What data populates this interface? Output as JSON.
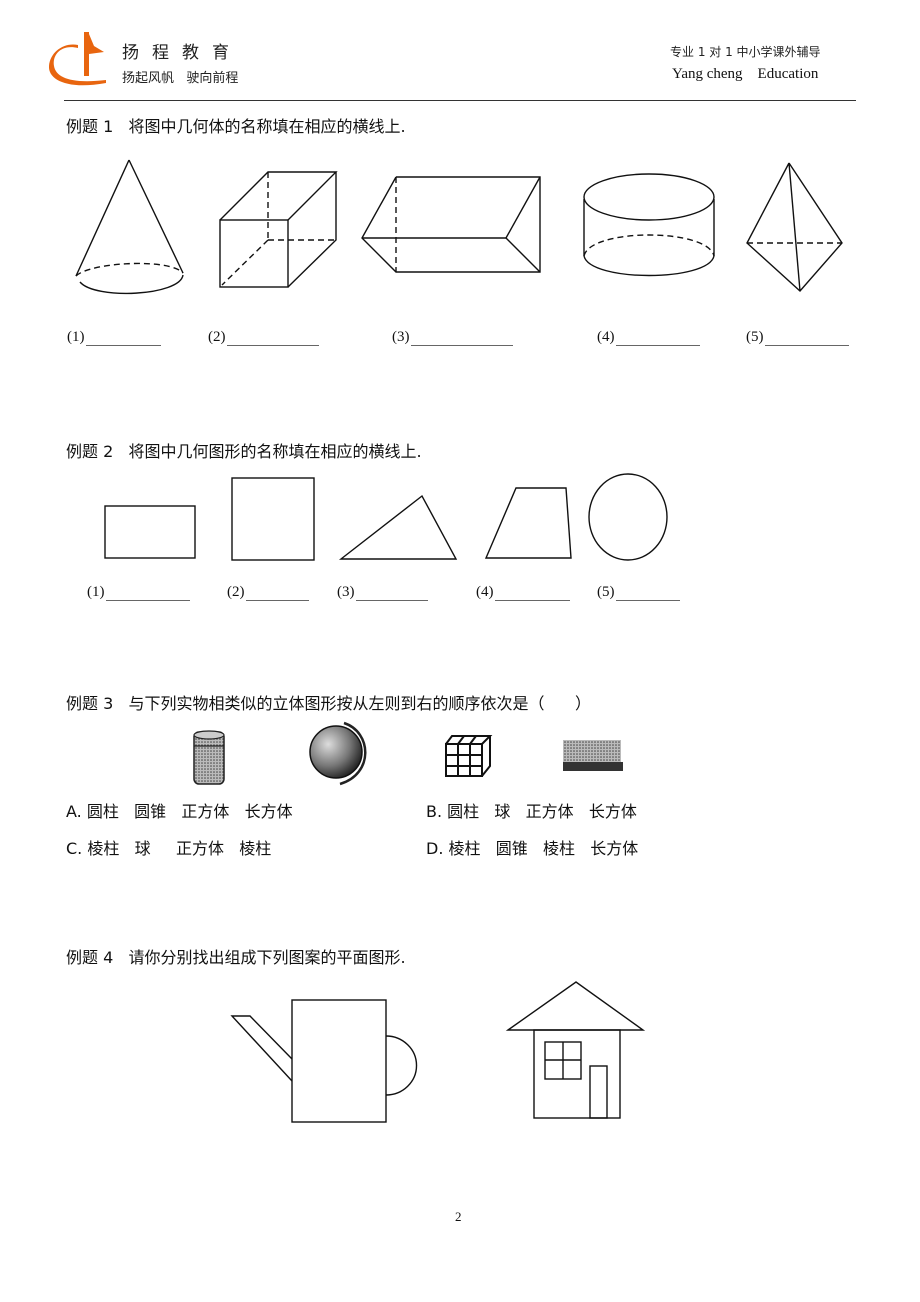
{
  "header": {
    "brand_name": "扬程教育",
    "brand_slogan": "扬起风帆   驶向前程",
    "tagline": "专业 1 对 1  中小学课外辅导",
    "brand_english": "Yang cheng    Education",
    "logo_color": "#E8650F"
  },
  "questions": [
    {
      "title": "例题 1   将图中几何体的名称填在相应的横线上.",
      "figures": [
        "cone",
        "cuboid",
        "triangular-prism",
        "cylinder",
        "triangular-bipyramid"
      ],
      "blanks": [
        "(1)",
        "(2)",
        "(3)",
        "(4)",
        "(5)"
      ]
    },
    {
      "title": "例题 2   将图中几何图形的名称填在相应的横线上.",
      "figures": [
        "rectangle",
        "square",
        "triangle",
        "trapezoid",
        "circle"
      ],
      "blanks": [
        "(1)",
        "(2)",
        "(3)",
        "(4)",
        "(5)"
      ]
    },
    {
      "title": "例题 3   与下列实物相类似的立体图形按从左则到右的顺序依次是（      ）",
      "objects": [
        "jar",
        "globe",
        "rubiks-cube",
        "brick"
      ],
      "options": [
        {
          "label": "A.",
          "text": "圆柱   圆锥   正方体   长方体"
        },
        {
          "label": "B.",
          "text": "圆柱   球   正方体   长方体"
        },
        {
          "label": "C.",
          "text": "棱柱   球     正方体   棱柱"
        },
        {
          "label": "D.",
          "text": "棱柱   圆锥   棱柱   长方体"
        }
      ]
    },
    {
      "title": "例题 4   请你分别找出组成下列图案的平面图形.",
      "figures": [
        "watering-can",
        "house"
      ]
    }
  ],
  "footer": {
    "page_number": "2"
  }
}
